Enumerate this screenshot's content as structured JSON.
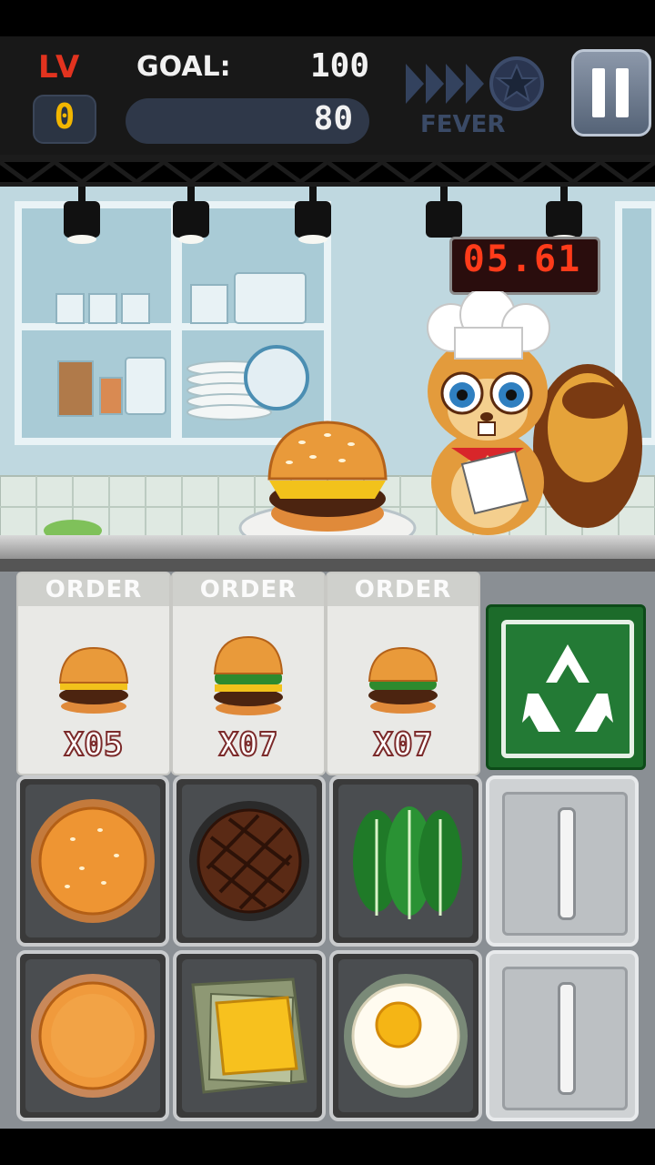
{
  "hud": {
    "level_label": "LV",
    "level_value": "0",
    "goal_label": "GOAL:",
    "goal_value": "100",
    "score_value": "80",
    "fever_label": "FEVER"
  },
  "timer": {
    "value": "05.61"
  },
  "orders": [
    {
      "header": "ORDER",
      "quantity": "X05",
      "burger": "cheeseburger"
    },
    {
      "header": "ORDER",
      "quantity": "X07",
      "burger": "lettuce-cheeseburger"
    },
    {
      "header": "ORDER",
      "quantity": "X07",
      "burger": "lettuce-burger"
    }
  ],
  "ingredients": [
    {
      "name": "top-bun"
    },
    {
      "name": "beef-patty"
    },
    {
      "name": "lettuce"
    },
    {
      "name": "bottom-bun"
    },
    {
      "name": "cheese-slice"
    },
    {
      "name": "fried-egg"
    }
  ],
  "icons": {
    "pause": "pause-icon",
    "recycle": "recycle-icon",
    "fever": "star-icon"
  },
  "colors": {
    "level_red": "#e2331f",
    "level_yellow": "#f2b600",
    "timer_red": "#ff3b1a",
    "recycle_green": "#1c6b2a"
  }
}
